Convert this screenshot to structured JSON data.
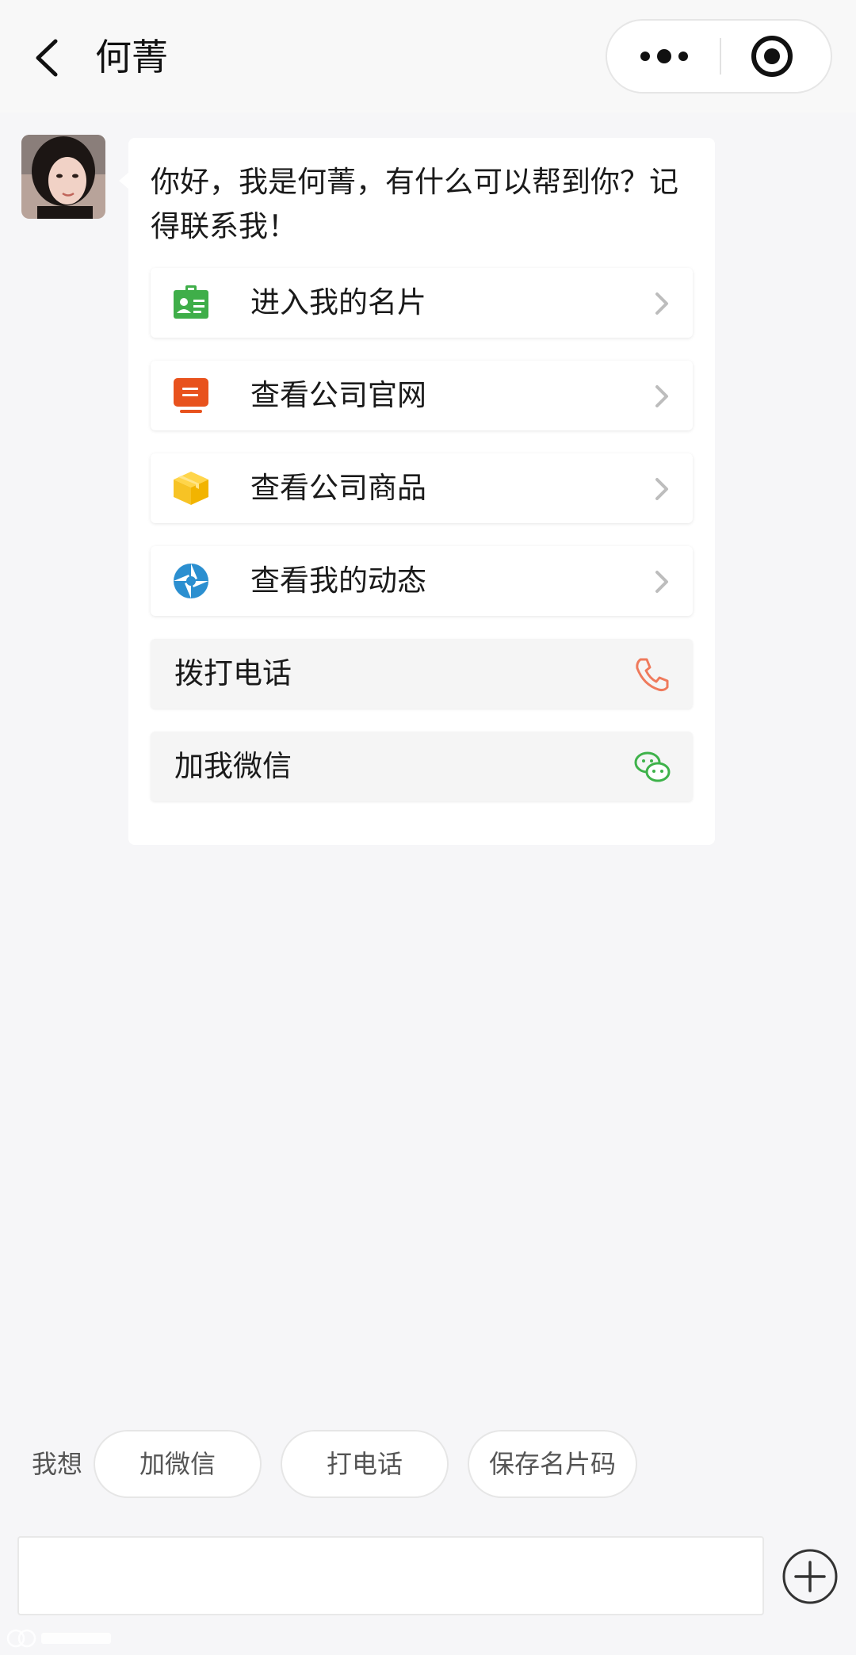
{
  "header": {
    "title": "何菁",
    "back_icon": "chevron-left-icon",
    "more_icon": "more-dots-icon",
    "close_icon": "target-close-icon"
  },
  "chat": {
    "greeting": "你好，我是何菁，有什么可以帮到你？记得联系我！",
    "menu": [
      {
        "label": "进入我的名片",
        "icon": "business-card-icon",
        "icon_color": "#3fae49"
      },
      {
        "label": "查看公司官网",
        "icon": "website-icon",
        "icon_color": "#e8521d"
      },
      {
        "label": "查看公司商品",
        "icon": "product-box-icon",
        "icon_color": "#f7c325"
      },
      {
        "label": "查看我的动态",
        "icon": "camera-shutter-icon",
        "icon_color": "#2b8fd0"
      }
    ],
    "actions": [
      {
        "label": "拨打电话",
        "icon": "phone-icon",
        "icon_color": "#ef7a5c"
      },
      {
        "label": "加我微信",
        "icon": "wechat-icon",
        "icon_color": "#3eb24a"
      }
    ]
  },
  "bottom": {
    "want_label": "我想",
    "chips": [
      "加微信",
      "打电话",
      "保存名片码"
    ],
    "input_placeholder": "",
    "plus_icon": "plus-circle-icon"
  },
  "colors": {
    "background": "#f6f6f8",
    "bubble": "#ffffff"
  }
}
